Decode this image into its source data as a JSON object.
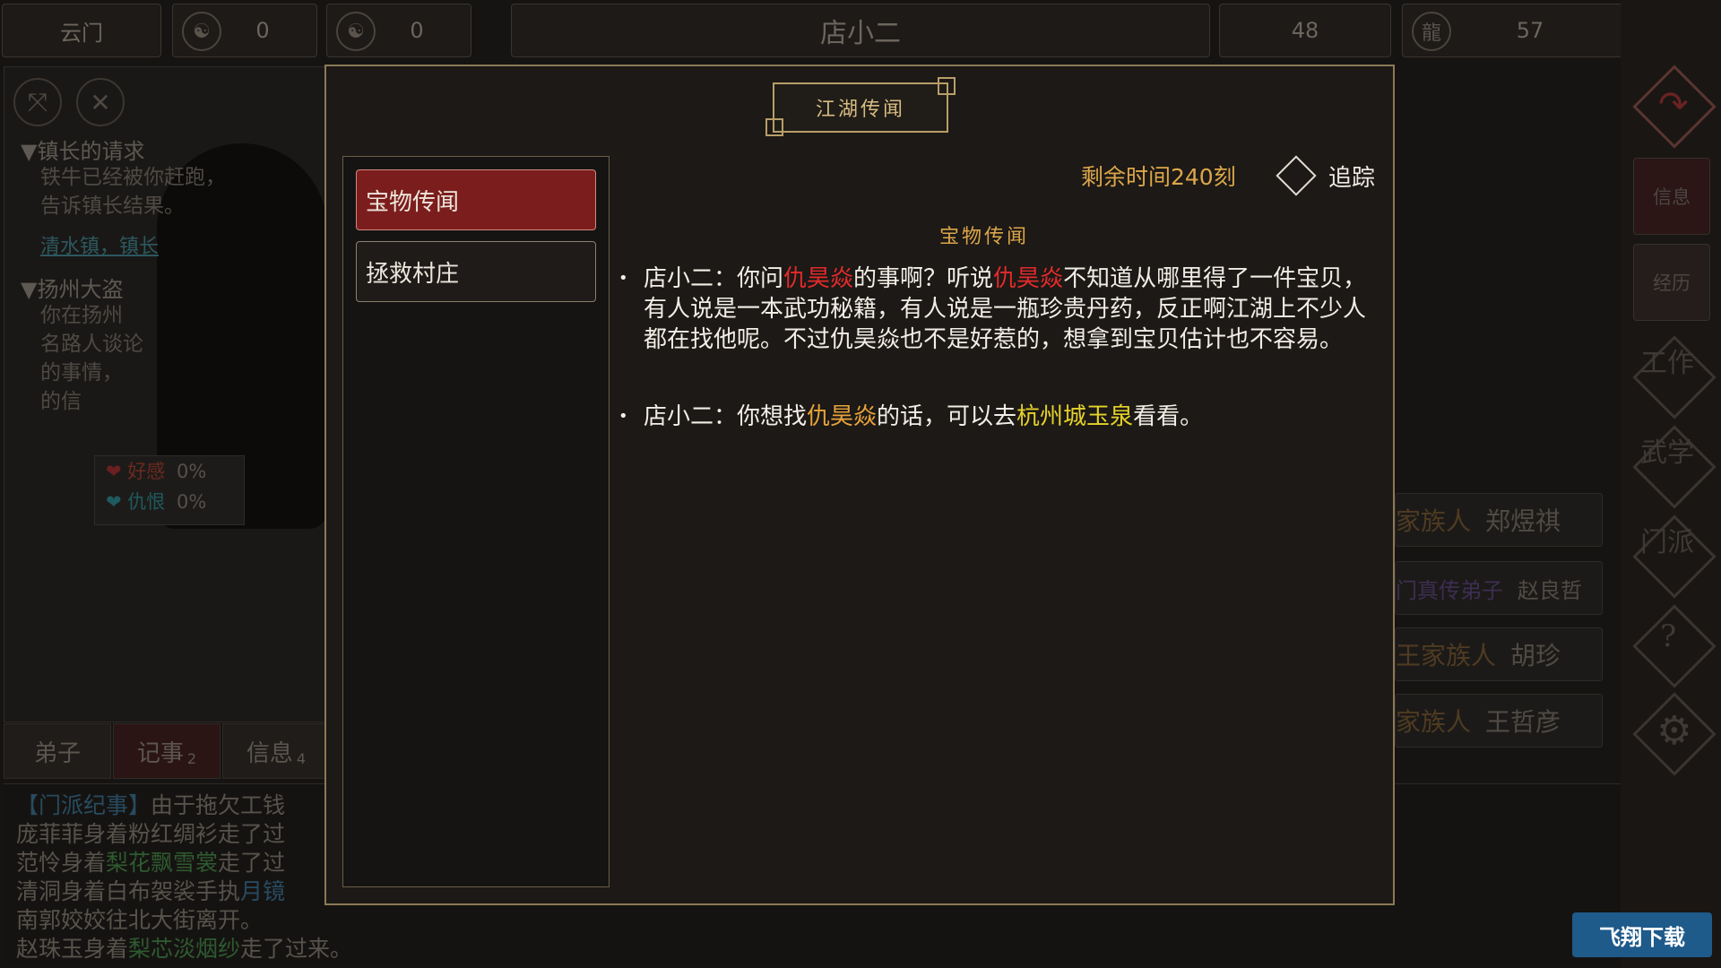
{
  "top_bar": {
    "sect_name": "云门",
    "reputation_icon": "reputation-seal-icon",
    "reputation_value": "0",
    "yinyang_icon": "yin-yang-icon",
    "yinyang_value": "0",
    "npc_name": "店小二",
    "value_a": "48",
    "beast_icon": "dragon-icon",
    "value_b": "57"
  },
  "left_panel": {
    "quests": [
      {
        "title": "▼镇长的请求",
        "lines": [
          "铁牛已经被你赶跑，",
          "告诉镇长结果。"
        ],
        "link": "清水镇，镇长"
      },
      {
        "title": "▼扬州大盗",
        "lines": [
          "你在扬州",
          "名路人谈论",
          "的事情，",
          "的信"
        ]
      }
    ],
    "favor": {
      "like_label": "好感",
      "like_value": "0%",
      "hate_label": "仇恨",
      "hate_value": "0%"
    }
  },
  "bottom_tabs": [
    {
      "label": "弟子",
      "badge": ""
    },
    {
      "label": "记事",
      "badge": "2"
    },
    {
      "label": "信息",
      "badge": "4"
    }
  ],
  "log": {
    "line1_a": "【门派纪事】",
    "line1_b": "由于拖欠工钱",
    "line2": "庞菲菲身着粉红绸衫走了过",
    "line3_a": "范怜身着",
    "line3_b": "梨花飘雪裳",
    "line3_c": "走了过",
    "line4_a": "清洞身着白布袈裟手执",
    "line4_b": "月镜",
    "line5": "南郭姣姣往北大街离开。",
    "line6_a": "赵珠玉身着",
    "line6_b": "梨芯淡烟纱",
    "line6_c": "走了过来。"
  },
  "right_side": {
    "side_buttons": [
      "信息",
      "经历"
    ],
    "diamond_labels": [
      "工作",
      "武学",
      "门派",
      "?"
    ],
    "npcs": [
      {
        "kind": "家族人",
        "name": "郑煜祺"
      },
      {
        "kind": "门真传弟子",
        "name": "赵良哲"
      },
      {
        "kind": "王家族人",
        "name": "胡珍"
      },
      {
        "kind": "家族人",
        "name": "王哲彦"
      }
    ]
  },
  "modal": {
    "header": "江湖传闻",
    "list_items": [
      "宝物传闻",
      "拯救村庄"
    ],
    "timer": "剩余时间240刻",
    "track_label": "追踪",
    "rumor_title": "宝物传闻",
    "dialog1": {
      "p1": "店小二：你问",
      "n1": "仇昊焱",
      "p2": "的事啊？听说",
      "n2": "仇昊焱",
      "p3": "不知道从哪里得了一件宝贝，有人说是一本武功秘籍，有人说是一瓶珍贵丹药，反正啊江湖上不少人都在找他呢。不过仇昊焱也不是好惹的，想拿到宝贝估计也不容易。"
    },
    "dialog2": {
      "p1": "店小二：你想找",
      "n1": "仇昊焱",
      "p2": "的话，可以去",
      "place": "杭州城玉泉",
      "p3": "看看。"
    }
  },
  "watermark": "飞翔下载",
  "colors": {
    "accent_gold": "#dca64a",
    "active_red": "#7c1d1d",
    "name_red": "#e22b2b",
    "name_orange": "#e8a33a",
    "place_yellow": "#e6d22a"
  }
}
